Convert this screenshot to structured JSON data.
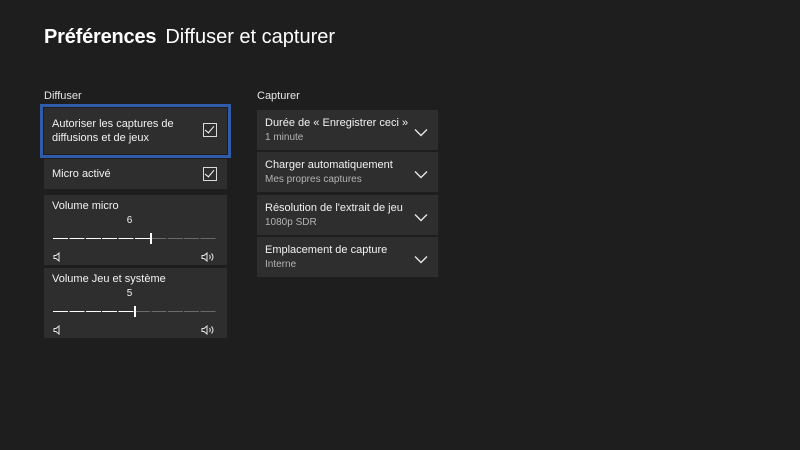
{
  "header": {
    "title": "Préférences",
    "subtitle": "Diffuser et capturer"
  },
  "broadcast": {
    "section_label": "Diffuser",
    "allow_captures": {
      "label": "Autoriser les captures de diffusions et de jeux",
      "checked": true
    },
    "mic_enabled": {
      "label": "Micro activé",
      "checked": true
    },
    "mic_volume": {
      "label": "Volume micro",
      "value": "6",
      "level": 0.6
    },
    "game_volume": {
      "label": "Volume Jeu et système",
      "value": "5",
      "level": 0.5
    }
  },
  "capture": {
    "section_label": "Capturer",
    "items": [
      {
        "title": "Durée de « Enregistrer ceci »",
        "value": "1 minute"
      },
      {
        "title": "Charger automatiquement",
        "value": "Mes propres captures"
      },
      {
        "title": "Résolution de l'extrait de jeu",
        "value": "1080p SDR"
      },
      {
        "title": "Emplacement de capture",
        "value": "Interne"
      }
    ]
  },
  "colors": {
    "background": "#1e1e1e",
    "tile": "#2e2e2e",
    "focus": "#2f5ba8"
  },
  "icons": [
    "checkbox-checked-icon",
    "volume-low-icon",
    "volume-high-icon",
    "chevron-down-icon"
  ]
}
